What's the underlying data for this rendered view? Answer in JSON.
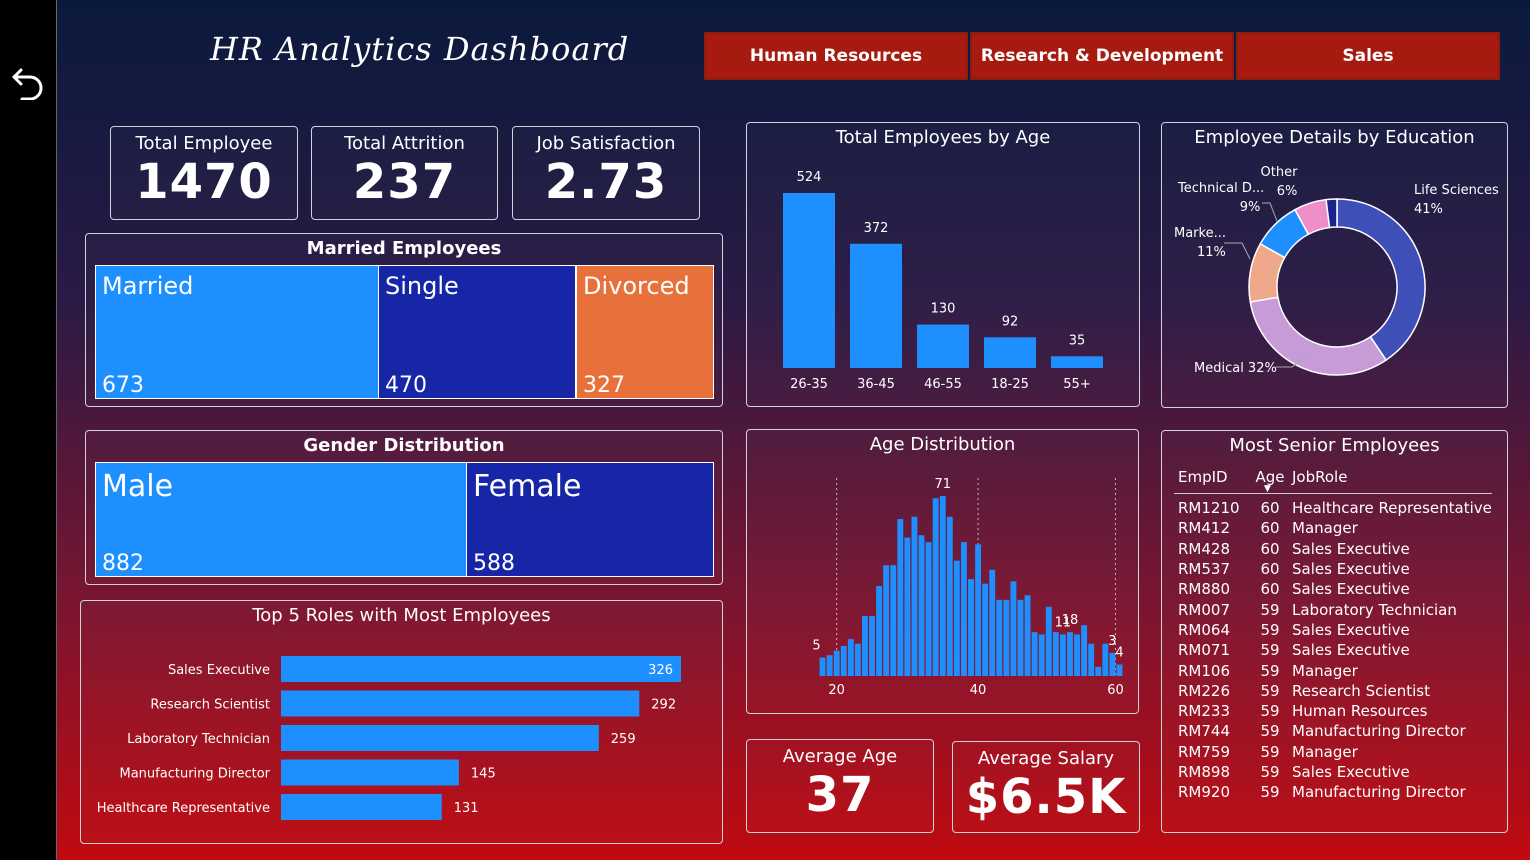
{
  "header": {
    "title": "HR Analytics Dashboard",
    "nav": [
      "Human Resources",
      "Research & Development",
      "Sales"
    ]
  },
  "kpis": {
    "total_employee": {
      "label": "Total Employee",
      "value": "1470"
    },
    "total_attrition": {
      "label": "Total Attrition",
      "value": "237"
    },
    "job_satisfaction": {
      "label": "Job Satisfaction",
      "value": "2.73"
    },
    "average_age": {
      "label": "Average Age",
      "value": "37"
    },
    "average_salary": {
      "label": "Average Salary",
      "value": "$6.5K"
    }
  },
  "married": {
    "title": "Married Employees",
    "cells": [
      {
        "label": "Married",
        "value": "673",
        "color": "#1e8fff"
      },
      {
        "label": "Single",
        "value": "470",
        "color": "#1626a6"
      },
      {
        "label": "Divorced",
        "value": "327",
        "color": "#e8703a"
      }
    ]
  },
  "gender": {
    "title": "Gender Distribution",
    "cells": [
      {
        "label": "Male",
        "value": "882",
        "color": "#1e8fff"
      },
      {
        "label": "Female",
        "value": "588",
        "color": "#1626a6"
      }
    ]
  },
  "senior": {
    "title": "Most Senior Employees",
    "headers": [
      "EmpID",
      "Age",
      "JobRole"
    ],
    "rows": [
      [
        "RM1210",
        "60",
        "Healthcare Representative"
      ],
      [
        "RM412",
        "60",
        "Manager"
      ],
      [
        "RM428",
        "60",
        "Sales Executive"
      ],
      [
        "RM537",
        "60",
        "Sales Executive"
      ],
      [
        "RM880",
        "60",
        "Sales Executive"
      ],
      [
        "RM007",
        "59",
        "Laboratory Technician"
      ],
      [
        "RM064",
        "59",
        "Sales Executive"
      ],
      [
        "RM071",
        "59",
        "Sales Executive"
      ],
      [
        "RM106",
        "59",
        "Manager"
      ],
      [
        "RM226",
        "59",
        "Research Scientist"
      ],
      [
        "RM233",
        "59",
        "Human Resources"
      ],
      [
        "RM744",
        "59",
        "Manufacturing Director"
      ],
      [
        "RM759",
        "59",
        "Manager"
      ],
      [
        "RM898",
        "59",
        "Sales Executive"
      ],
      [
        "RM920",
        "59",
        "Manufacturing Director"
      ]
    ]
  },
  "chart_data": [
    {
      "type": "bar",
      "title": "Total Employees by Age",
      "categories": [
        "26-35",
        "36-45",
        "46-55",
        "18-25",
        "55+"
      ],
      "values": [
        524,
        372,
        130,
        92,
        35
      ],
      "color": "#1e8fff"
    },
    {
      "type": "pie",
      "title": "Employee Details by Education",
      "slices": [
        {
          "label": "Life Sciences",
          "pct_label": "41%",
          "value": 41,
          "color": "#3f4fb8"
        },
        {
          "label": "Medical",
          "pct_label": "32%",
          "value": 32,
          "color": "#c79ad8"
        },
        {
          "label": "Marke...",
          "pct_label": "11%",
          "value": 11,
          "color": "#f0a88a"
        },
        {
          "label": "Technical D...",
          "pct_label": "9%",
          "value": 9,
          "color": "#1e8fff"
        },
        {
          "label": "Other",
          "pct_label": "6%",
          "value": 6,
          "color": "#ee8ec8"
        },
        {
          "label": "",
          "pct_label": "",
          "value": 2,
          "color": "#1a2490"
        }
      ]
    },
    {
      "type": "bar",
      "title": "Top 5 Roles with Most Employees",
      "orientation": "horizontal",
      "categories": [
        "Sales Executive",
        "Research Scientist",
        "Laboratory Technician",
        "Manufacturing Director",
        "Healthcare Representative"
      ],
      "values": [
        326,
        292,
        259,
        145,
        131
      ],
      "color": "#1e8fff"
    },
    {
      "type": "bar",
      "title": "Age Distribution",
      "x": [
        18,
        19,
        20,
        21,
        22,
        23,
        24,
        25,
        26,
        27,
        28,
        29,
        30,
        31,
        32,
        33,
        34,
        35,
        36,
        37,
        38,
        39,
        40,
        41,
        42,
        43,
        44,
        45,
        46,
        47,
        48,
        49,
        50,
        51,
        52,
        53,
        54,
        55,
        56,
        57,
        58,
        59,
        60
      ],
      "values": [
        8,
        9,
        11,
        13,
        16,
        14,
        26,
        26,
        39,
        48,
        48,
        68,
        60,
        69,
        61,
        58,
        77,
        78,
        69,
        50,
        58,
        42,
        57,
        40,
        46,
        33,
        33,
        41,
        33,
        35,
        19,
        18,
        30,
        19,
        18,
        19,
        18,
        22,
        14,
        4,
        14,
        10,
        5
      ],
      "point_labels": [
        {
          "x": 18,
          "text": "5"
        },
        {
          "x": 35,
          "text": "71"
        },
        {
          "x": 53,
          "text": "18"
        },
        {
          "x": 52,
          "text": "11"
        },
        {
          "x": 59,
          "text": "3"
        },
        {
          "x": 60,
          "text": "4"
        }
      ],
      "xticks": [
        20,
        40,
        60
      ],
      "color": "#1e8fff"
    }
  ]
}
